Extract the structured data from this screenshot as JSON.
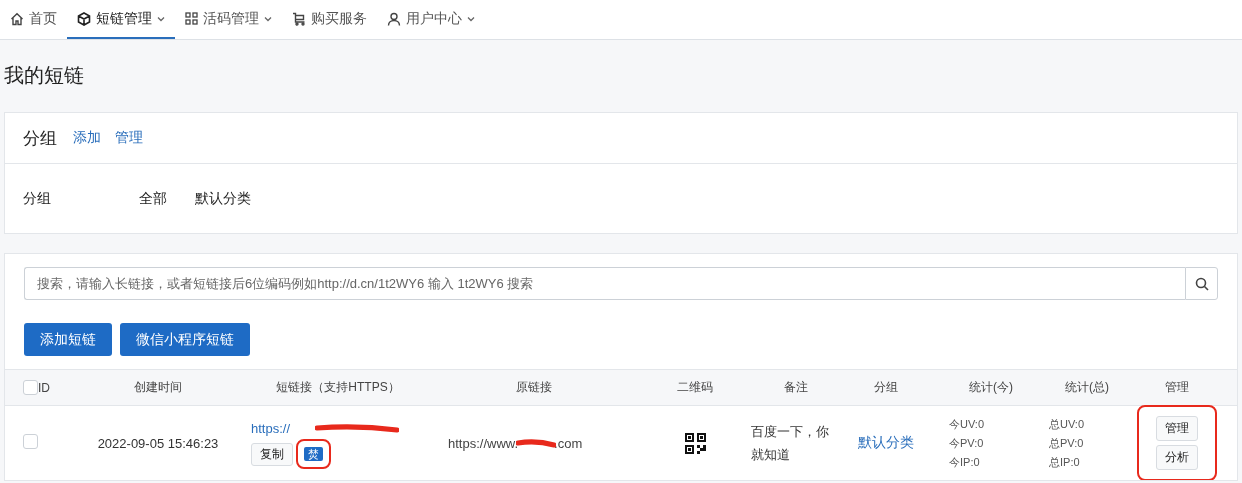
{
  "nav": [
    {
      "label": "首页",
      "has_dropdown": false,
      "selected": false
    },
    {
      "label": "短链管理",
      "has_dropdown": true,
      "selected": true
    },
    {
      "label": "活码管理",
      "has_dropdown": true,
      "selected": false
    },
    {
      "label": "购买服务",
      "has_dropdown": false,
      "selected": false
    },
    {
      "label": "用户中心",
      "has_dropdown": true,
      "selected": false
    }
  ],
  "page_title": "我的短链",
  "group_card": {
    "title": "分组",
    "actions": [
      "添加",
      "管理"
    ],
    "filter_label": "分组",
    "filters": [
      "全部",
      "默认分类"
    ]
  },
  "search": {
    "placeholder": "搜索，请输入长链接，或者短链接后6位编码例如http://d.cn/1t2WY6 输入 1t2WY6 搜索"
  },
  "buttons": [
    "添加短链",
    "微信小程序短链"
  ],
  "table": {
    "select_all_checked": false,
    "columns": [
      "ID",
      "创建时间",
      "短链接（支持HTTPS）",
      "原链接",
      "二维码",
      "备注",
      "分组",
      "统计(今)",
      "统计(总)",
      "管理"
    ],
    "rows": [
      {
        "checked": false,
        "created": "2022-09-05 15:46:23",
        "short_link": "https://",
        "short_link_redacted": true,
        "copy_label": "复制",
        "tag": "焚",
        "tag_highlighted": true,
        "original_link_start": "https://www.",
        "original_link_end": ".com",
        "original_link_redacted": true,
        "note": "百度一下，你就知道",
        "group": "默认分类",
        "today_stats": [
          "今UV:0",
          "今PV:0",
          "今IP:0"
        ],
        "total_stats": [
          "总UV:0",
          "总PV:0",
          "总IP:0"
        ],
        "actions": [
          "管理",
          "分析"
        ],
        "actions_highlighted": true
      }
    ]
  }
}
